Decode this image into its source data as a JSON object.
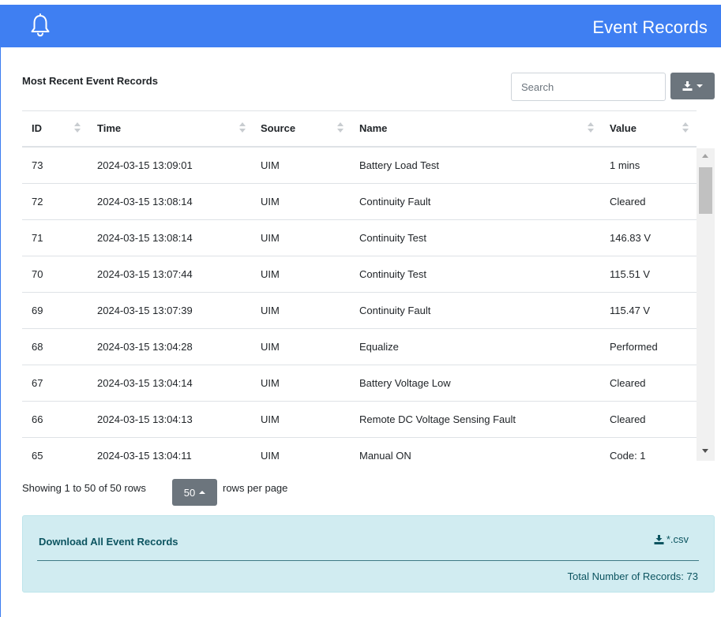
{
  "header": {
    "title": "Event Records",
    "color": "#3f7ff2"
  },
  "panel": {
    "section_title": "Most Recent Event Records",
    "search_placeholder": "Search",
    "export_icon": "download-icon"
  },
  "table": {
    "columns": [
      "ID",
      "Time",
      "Source",
      "Name",
      "Value"
    ],
    "rows": [
      {
        "id": "73",
        "time": "2024-03-15 13:09:01",
        "source": "UIM",
        "name": "Battery Load Test",
        "value": "1 mins"
      },
      {
        "id": "72",
        "time": "2024-03-15 13:08:14",
        "source": "UIM",
        "name": "Continuity Fault",
        "value": "Cleared"
      },
      {
        "id": "71",
        "time": "2024-03-15 13:08:14",
        "source": "UIM",
        "name": "Continuity Test",
        "value": "146.83 V"
      },
      {
        "id": "70",
        "time": "2024-03-15 13:07:44",
        "source": "UIM",
        "name": "Continuity Test",
        "value": "115.51 V"
      },
      {
        "id": "69",
        "time": "2024-03-15 13:07:39",
        "source": "UIM",
        "name": "Continuity Fault",
        "value": "115.47 V"
      },
      {
        "id": "68",
        "time": "2024-03-15 13:04:28",
        "source": "UIM",
        "name": "Equalize",
        "value": "Performed"
      },
      {
        "id": "67",
        "time": "2024-03-15 13:04:14",
        "source": "UIM",
        "name": "Battery Voltage Low",
        "value": "Cleared"
      },
      {
        "id": "66",
        "time": "2024-03-15 13:04:13",
        "source": "UIM",
        "name": "Remote DC Voltage Sensing Fault",
        "value": "Cleared"
      },
      {
        "id": "65",
        "time": "2024-03-15 13:04:11",
        "source": "UIM",
        "name": "Manual ON",
        "value": "Code: 1"
      }
    ]
  },
  "pagination": {
    "showing_text": "Showing 1 to 50 of 50 rows",
    "page_size": "50",
    "rows_per_page_label": "rows per page"
  },
  "download": {
    "title": "Download All Event Records",
    "csv_label": "*.csv",
    "total_text": "Total Number of Records: 73",
    "color": "#0c5460",
    "background": "#d1ecf1"
  }
}
